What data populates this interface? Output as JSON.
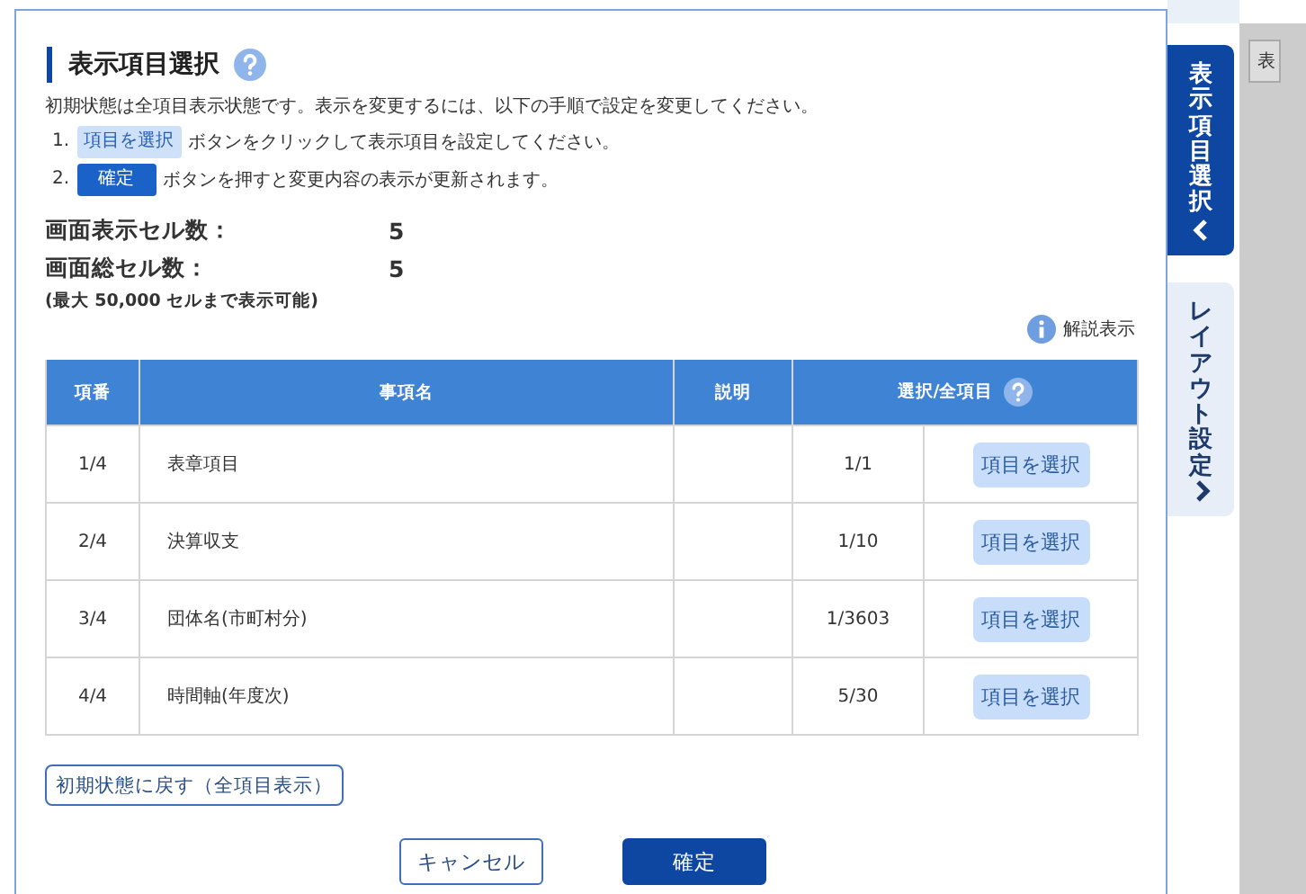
{
  "dialog": {
    "title": "表示項目選択",
    "intro": "初期状態は全項目表示状態です。表示を変更するには、以下の手順で設定を変更してください。",
    "steps": [
      {
        "number": "1.",
        "chip": "項目を選択",
        "kind": "light",
        "text": "ボタンをクリックして表示項目を設定してください。"
      },
      {
        "number": "2.",
        "chip": "確定",
        "kind": "dark",
        "text": "ボタンを押すと変更内容の表示が更新されます。"
      }
    ],
    "counts": [
      {
        "label": "画面表示セル数：",
        "value": "5"
      },
      {
        "label": "画面総セル数：",
        "value": "5"
      }
    ],
    "note": "(最大 50,000 セルまで表示可能)",
    "help_link": "解説表示",
    "table": {
      "columns": [
        "項番",
        "事項名",
        "説明",
        "選択/全項目"
      ],
      "rows": [
        {
          "number": "1/4",
          "name": "表章項目",
          "ratio": "1/1",
          "button": "項目を選択"
        },
        {
          "number": "2/4",
          "name": "決算収支",
          "ratio": "1/10",
          "button": "項目を選択"
        },
        {
          "number": "3/4",
          "name": "団体名(市町村分)",
          "ratio": "1/3603",
          "button": "項目を選択"
        },
        {
          "number": "4/4",
          "name": "時間軸(年度次)",
          "ratio": "5/30",
          "button": "項目を選択"
        }
      ]
    },
    "reset_button": "初期状態に戻す（全項目表示）",
    "buttons": [
      {
        "label": "キャンセル",
        "kind": "secondary"
      },
      {
        "label": "確定",
        "kind": "primary"
      }
    ]
  },
  "side_tabs": [
    {
      "label": "表示項目選択",
      "selected": true
    },
    {
      "label": "レイアウト設定",
      "selected": false
    }
  ],
  "background_label": "表"
}
